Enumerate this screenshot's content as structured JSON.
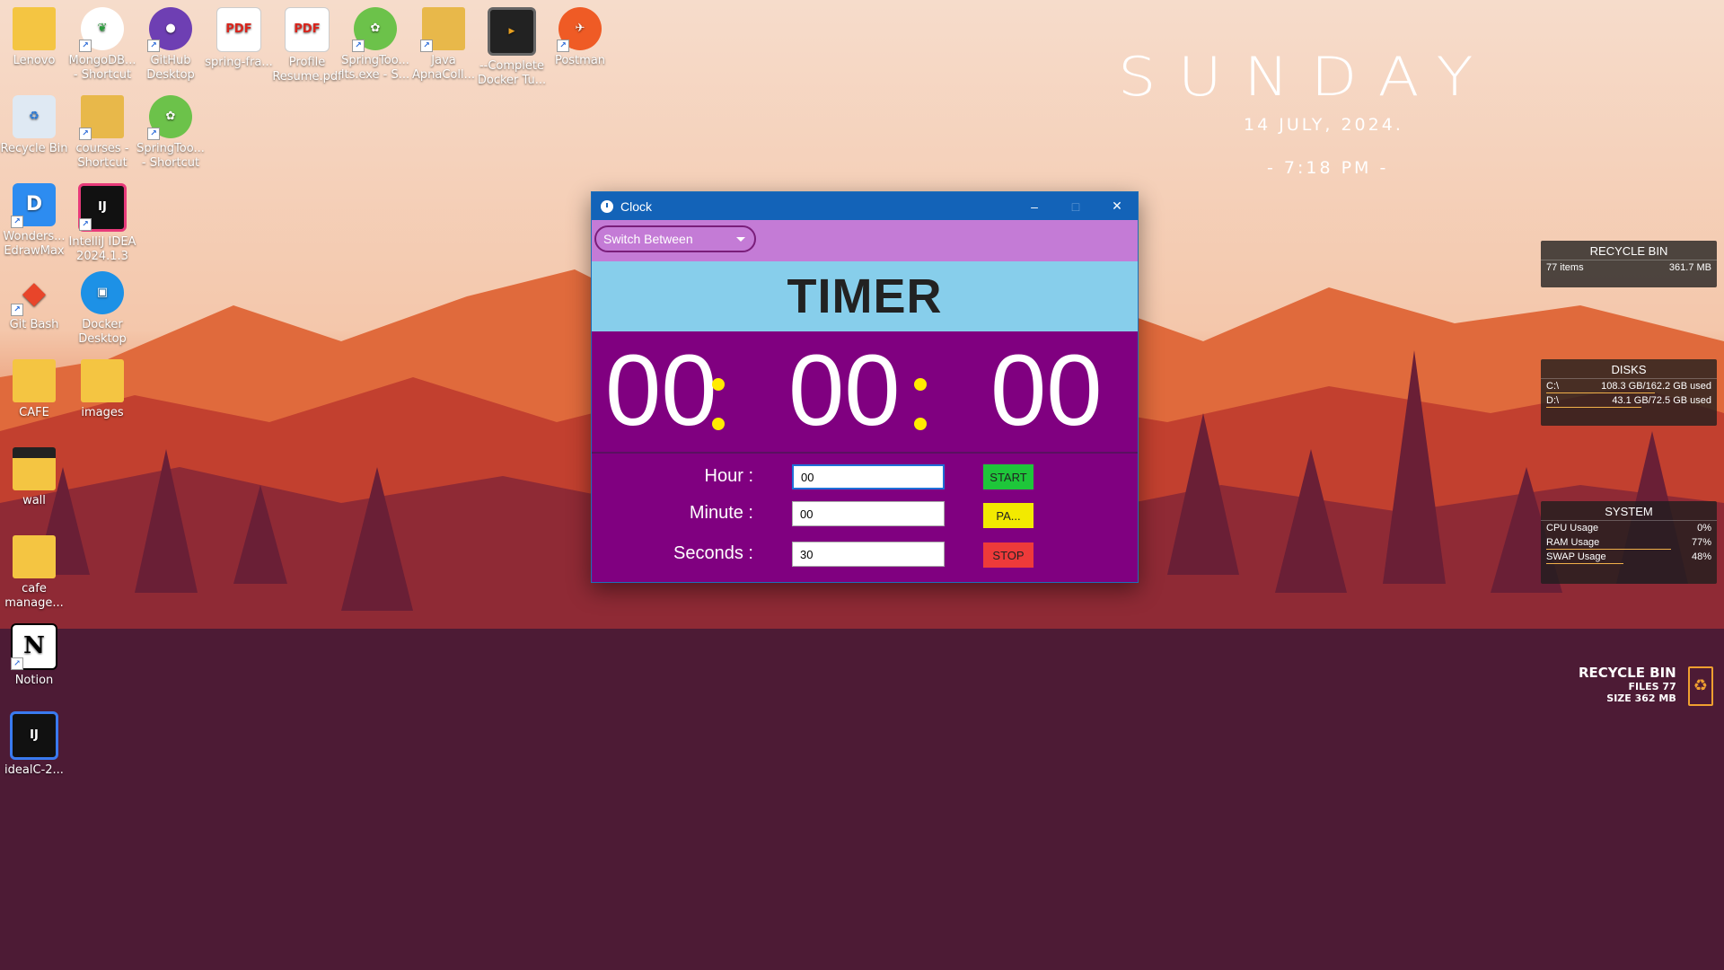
{
  "desktop": {
    "icons": [
      {
        "label": "Lenovo"
      },
      {
        "label": "MongoDB... - Shortcut"
      },
      {
        "label": "GitHub Desktop"
      },
      {
        "label": "spring-fra..."
      },
      {
        "label": "Profile Resume.pdf"
      },
      {
        "label": "SpringToo... lts.exe - S..."
      },
      {
        "label": "Java ApnaColl..."
      },
      {
        "label": "--Complete Docker Tu..."
      },
      {
        "label": "Postman"
      },
      {
        "label": "Recycle Bin"
      },
      {
        "label": "courses - Shortcut"
      },
      {
        "label": "SpringToo... - Shortcut"
      },
      {
        "label": "Wonders... EdrawMax"
      },
      {
        "label": "IntelliJ IDEA 2024.1.3"
      },
      {
        "label": "Git Bash"
      },
      {
        "label": "Docker Desktop"
      },
      {
        "label": "CAFE"
      },
      {
        "label": "images"
      },
      {
        "label": "wall"
      },
      {
        "label": "cafe manage..."
      },
      {
        "label": "Notion"
      },
      {
        "label": "idealC-2..."
      }
    ],
    "pdf_text": "PDF",
    "ij_text": "IJ",
    "notion_text": "N"
  },
  "clock_widget": {
    "day": "SUNDAY",
    "date": "14 JULY, 2024.",
    "time": "- 7:18 PM -"
  },
  "recycle_widget": {
    "title": "RECYCLE BIN",
    "items": "77 items",
    "size": "361.7 MB"
  },
  "disks_widget": {
    "title": "DISKS",
    "disks": [
      {
        "name": "C:\\",
        "usage": "108.3 GB/162.2 GB used",
        "fill": 0.67
      },
      {
        "name": "D:\\",
        "usage": "43.1 GB/72.5 GB used",
        "fill": 0.59
      }
    ]
  },
  "system_widget": {
    "title": "SYSTEM",
    "rows": [
      {
        "name": "CPU Usage",
        "value": "0%",
        "fill": 0.0
      },
      {
        "name": "RAM Usage",
        "value": "77%",
        "fill": 0.77
      },
      {
        "name": "SWAP Usage",
        "value": "48%",
        "fill": 0.48
      }
    ]
  },
  "recycle_corner": {
    "title": "RECYCLE BIN",
    "files": "FILES 77",
    "size": "SIZE 362 MB"
  },
  "clock_window": {
    "title": "Clock",
    "dropdown_label": "Switch Between",
    "mode_title": "TIMER",
    "display": {
      "hours": "00",
      "minutes": "00",
      "seconds": "00"
    },
    "hour_label": "Hour :",
    "minute_label": "Minute :",
    "seconds_label": "Seconds :",
    "hour_value": "00",
    "minute_value": "00",
    "seconds_value": "30",
    "start_label": "START",
    "pause_label": "PA...",
    "stop_label": "STOP",
    "colors": {
      "start": "#1ec63a",
      "pause": "#f2ea00",
      "stop": "#ee3a3a",
      "titlebar": "#1363b8",
      "body": "#800080",
      "header": "#87ceeb"
    }
  }
}
